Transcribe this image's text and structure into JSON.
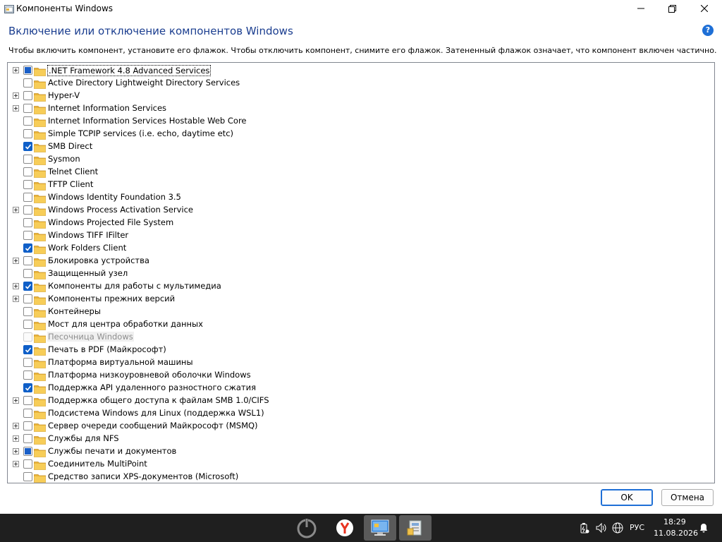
{
  "window": {
    "title": "Компоненты Windows",
    "heading": "Включение или отключение компонентов Windows",
    "description": "Чтобы включить компонент, установите его флажок. Чтобы отключить компонент, снимите его флажок. Затененный флажок означает, что компонент включен частично.",
    "help_glyph": "?"
  },
  "features": [
    {
      "label": ".NET Framework 4.8 Advanced Services",
      "state": "partial",
      "expandable": true,
      "selected": true,
      "disabled": false
    },
    {
      "label": "Active Directory Lightweight Directory Services",
      "state": "unchecked",
      "expandable": false,
      "selected": false,
      "disabled": false
    },
    {
      "label": "Hyper-V",
      "state": "unchecked",
      "expandable": true,
      "selected": false,
      "disabled": false
    },
    {
      "label": "Internet Information Services",
      "state": "unchecked",
      "expandable": true,
      "selected": false,
      "disabled": false
    },
    {
      "label": "Internet Information Services Hostable Web Core",
      "state": "unchecked",
      "expandable": false,
      "selected": false,
      "disabled": false
    },
    {
      "label": "Simple TCPIP services (i.e. echo, daytime etc)",
      "state": "unchecked",
      "expandable": false,
      "selected": false,
      "disabled": false
    },
    {
      "label": "SMB Direct",
      "state": "checked",
      "expandable": false,
      "selected": false,
      "disabled": false
    },
    {
      "label": "Sysmon",
      "state": "unchecked",
      "expandable": false,
      "selected": false,
      "disabled": false
    },
    {
      "label": "Telnet Client",
      "state": "unchecked",
      "expandable": false,
      "selected": false,
      "disabled": false
    },
    {
      "label": "TFTP Client",
      "state": "unchecked",
      "expandable": false,
      "selected": false,
      "disabled": false
    },
    {
      "label": "Windows Identity Foundation 3.5",
      "state": "unchecked",
      "expandable": false,
      "selected": false,
      "disabled": false
    },
    {
      "label": "Windows Process Activation Service",
      "state": "unchecked",
      "expandable": true,
      "selected": false,
      "disabled": false
    },
    {
      "label": "Windows Projected File System",
      "state": "unchecked",
      "expandable": false,
      "selected": false,
      "disabled": false
    },
    {
      "label": "Windows TIFF IFilter",
      "state": "unchecked",
      "expandable": false,
      "selected": false,
      "disabled": false
    },
    {
      "label": "Work Folders Client",
      "state": "checked",
      "expandable": false,
      "selected": false,
      "disabled": false
    },
    {
      "label": "Блокировка устройства",
      "state": "unchecked",
      "expandable": true,
      "selected": false,
      "disabled": false
    },
    {
      "label": "Защищенный узел",
      "state": "unchecked",
      "expandable": false,
      "selected": false,
      "disabled": false
    },
    {
      "label": "Компоненты для работы с мультимедиа",
      "state": "checked",
      "expandable": true,
      "selected": false,
      "disabled": false
    },
    {
      "label": "Компоненты прежних версий",
      "state": "unchecked",
      "expandable": true,
      "selected": false,
      "disabled": false
    },
    {
      "label": "Контейнеры",
      "state": "unchecked",
      "expandable": false,
      "selected": false,
      "disabled": false
    },
    {
      "label": "Мост для центра обработки данных",
      "state": "unchecked",
      "expandable": false,
      "selected": false,
      "disabled": false
    },
    {
      "label": "Песочница Windows",
      "state": "unchecked",
      "expandable": false,
      "selected": false,
      "disabled": true
    },
    {
      "label": "Печать в PDF (Майкрософт)",
      "state": "checked",
      "expandable": false,
      "selected": false,
      "disabled": false
    },
    {
      "label": "Платформа виртуальной машины",
      "state": "unchecked",
      "expandable": false,
      "selected": false,
      "disabled": false
    },
    {
      "label": "Платформа низкоуровневой оболочки Windows",
      "state": "unchecked",
      "expandable": false,
      "selected": false,
      "disabled": false
    },
    {
      "label": "Поддержка API удаленного разностного сжатия",
      "state": "checked",
      "expandable": false,
      "selected": false,
      "disabled": false
    },
    {
      "label": "Поддержка общего доступа к файлам SMB 1.0/CIFS",
      "state": "unchecked",
      "expandable": true,
      "selected": false,
      "disabled": false
    },
    {
      "label": "Подсистема Windows для Linux (поддержка WSL1)",
      "state": "unchecked",
      "expandable": false,
      "selected": false,
      "disabled": false
    },
    {
      "label": "Сервер очереди сообщений Майкрософт (MSMQ)",
      "state": "unchecked",
      "expandable": true,
      "selected": false,
      "disabled": false
    },
    {
      "label": "Службы для NFS",
      "state": "unchecked",
      "expandable": true,
      "selected": false,
      "disabled": false
    },
    {
      "label": "Службы печати и документов",
      "state": "partial",
      "expandable": true,
      "selected": false,
      "disabled": false
    },
    {
      "label": "Соединитель MultiPoint",
      "state": "unchecked",
      "expandable": true,
      "selected": false,
      "disabled": false
    },
    {
      "label": "Средство записи XPS-документов (Microsoft)",
      "state": "unchecked",
      "expandable": false,
      "selected": false,
      "disabled": false
    }
  ],
  "buttons": {
    "ok": "OK",
    "cancel": "Отмена"
  },
  "taskbar": {
    "apps": [
      "power-icon",
      "yandex-browser-icon",
      "control-panel-icon",
      "windows-features-icon"
    ],
    "language": "РУС",
    "time": "18:29",
    "date": "11.08.2026"
  },
  "colors": {
    "heading": "#1a3d8f",
    "accent": "#0f5fc8",
    "folder": "#f3c24a",
    "taskbar": "#1f1f1f"
  }
}
